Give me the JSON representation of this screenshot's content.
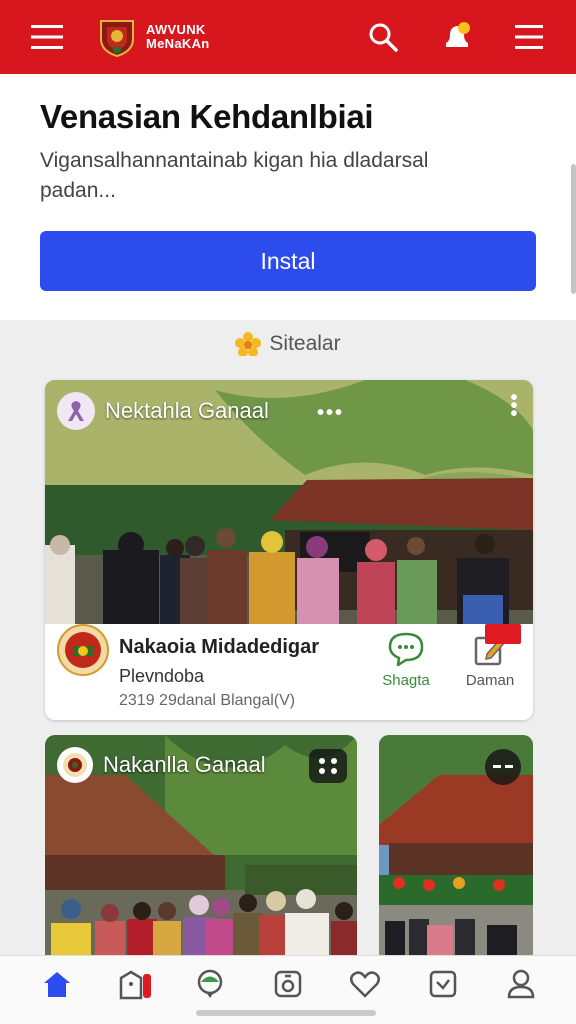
{
  "header": {
    "logo_text_line1": "AWVUNK",
    "logo_text_line2": "MeNaKAn",
    "icons": [
      "menu-icon",
      "search-icon",
      "notification-icon",
      "list-icon"
    ],
    "brand_color": "#d8161e"
  },
  "promo": {
    "title": "Venasian Kehdanlbiai",
    "subtitle": "Vigansalhannantainab kigan hia dladarsal padan...",
    "install_label": "Instal",
    "button_color": "#2d4ced"
  },
  "section": {
    "label": "Sitealar"
  },
  "feed": {
    "main_card": {
      "group_name": "Nektahla Ganaal",
      "title": "Nakaoia Midadedigar",
      "subtitle": "Plevndoba",
      "date": "2319 29danal Blangal(V)",
      "share_label": "Shagta",
      "domain_label": "Daman"
    },
    "card_b": {
      "group_name": "Nakanlla Ganaal"
    }
  },
  "bottom_nav": {
    "items": [
      "home-icon",
      "shop-icon",
      "map-pin-icon",
      "camera-icon",
      "heart-icon",
      "check-box-icon",
      "profile-icon"
    ],
    "active": "home-icon"
  }
}
